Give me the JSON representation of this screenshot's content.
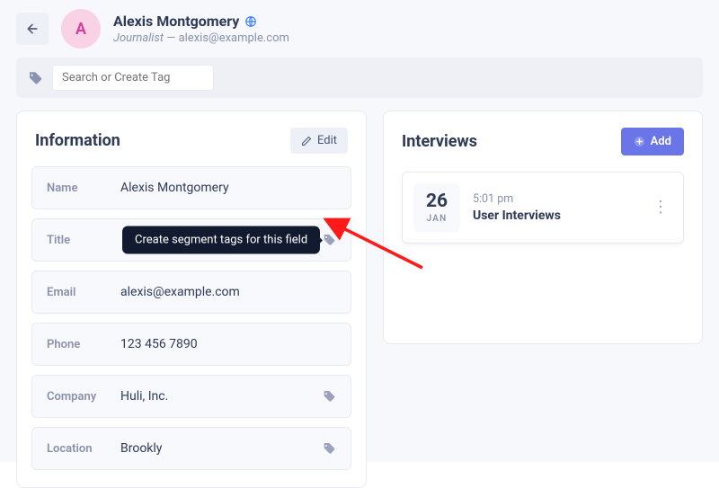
{
  "header": {
    "avatar_initial": "A",
    "name": "Alexis Montgomery",
    "role": "Journalist",
    "email": "alexis@example.com"
  },
  "tagbar": {
    "placeholder": "Search or Create Tag"
  },
  "info": {
    "title": "Information",
    "edit_label": "Edit",
    "tooltip": "Create segment tags for this field",
    "rows": [
      {
        "label": "Name",
        "value": "Alexis Montgomery",
        "taggable": false
      },
      {
        "label": "Title",
        "value": "",
        "taggable": true
      },
      {
        "label": "Email",
        "value": "alexis@example.com",
        "taggable": false
      },
      {
        "label": "Phone",
        "value": "123 456 7890",
        "taggable": false
      },
      {
        "label": "Company",
        "value": "Huli, Inc.",
        "taggable": true
      },
      {
        "label": "Location",
        "value": "Brookly",
        "taggable": true
      }
    ]
  },
  "interviews": {
    "title": "Interviews",
    "add_label": "Add",
    "items": [
      {
        "day": "26",
        "month": "JAN",
        "time": "5:01 pm",
        "title": "User Interviews"
      }
    ]
  }
}
